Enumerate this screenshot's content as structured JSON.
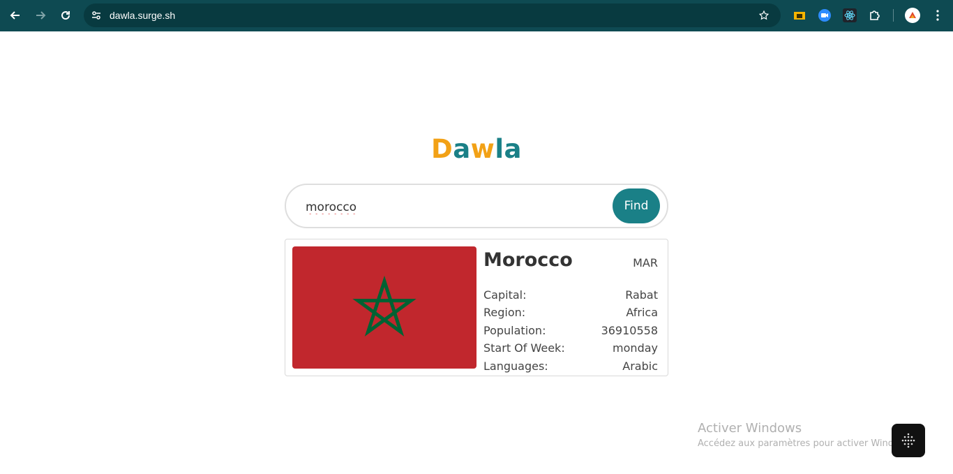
{
  "browser": {
    "url": "dawla.surge.sh"
  },
  "app": {
    "logo": [
      "D",
      "a",
      "w",
      "la"
    ],
    "search": {
      "value": "morocco",
      "button_label": "Find"
    },
    "result": {
      "name": "Morocco",
      "code": "MAR",
      "rows": [
        {
          "label": "Capital:",
          "value": "Rabat"
        },
        {
          "label": "Region:",
          "value": "Africa"
        },
        {
          "label": "Population:",
          "value": "36910558"
        },
        {
          "label": "Start Of Week:",
          "value": "monday"
        },
        {
          "label": "Languages:",
          "value": "Arabic"
        }
      ],
      "flag_colors": {
        "field": "#c1272d",
        "star": "#006233"
      }
    }
  },
  "overlay": {
    "watermark_title": "Activer Windows",
    "watermark_sub": "Accédez aux paramètres pour activer Windows."
  },
  "colors": {
    "chrome": "#0e4a52",
    "accent_teal": "#1a8087",
    "accent_orange": "#f2a116"
  }
}
